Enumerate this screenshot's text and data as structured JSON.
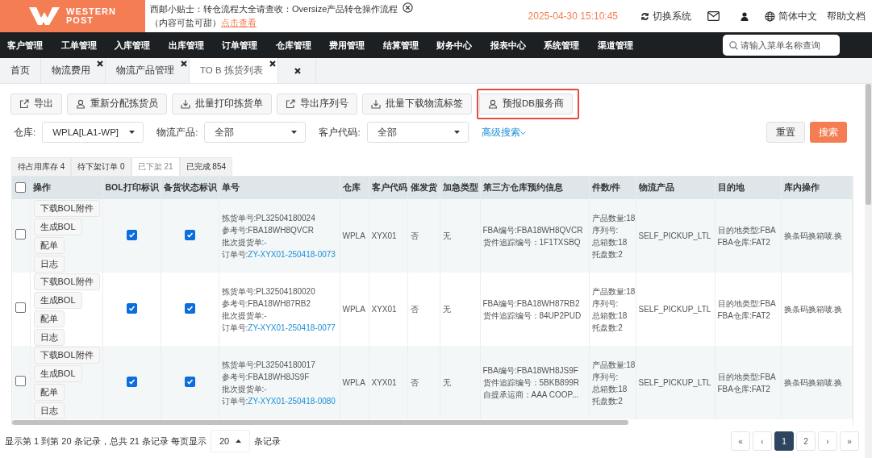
{
  "header": {
    "logo_text": [
      "WESTERN",
      "POST"
    ],
    "notice": {
      "line1": "西邮小贴士：转仓流程大全请查收：Oversize产品转仓操作流程",
      "line2": "（内容可盐可甜）",
      "link": "点击查看"
    },
    "datetime": "2025-04-30 15:10:45",
    "switch_system": "切换系统",
    "language": "简体中文",
    "help": "帮助文档"
  },
  "nav": {
    "items": [
      "客户管理",
      "工单管理",
      "入库管理",
      "出库管理",
      "订单管理",
      "仓库管理",
      "费用管理",
      "结算管理",
      "财务中心",
      "报表中心",
      "系统管理",
      "渠道管理"
    ],
    "search_placeholder": "请输入菜单名称查询"
  },
  "page_tabs": [
    {
      "label": "首页",
      "closable": false,
      "selected": false
    },
    {
      "label": "物流费用",
      "closable": true,
      "selected": false
    },
    {
      "label": "物流产品管理",
      "closable": true,
      "selected": false
    },
    {
      "label": "TO B 拣货列表",
      "closable": true,
      "selected": true
    },
    {
      "closable": true,
      "selected": false
    }
  ],
  "toolbar": [
    {
      "label": "导出",
      "highlighted": false
    },
    {
      "label": "重新分配拣货员",
      "highlighted": false
    },
    {
      "label": "批量打印拣货单",
      "highlighted": false
    },
    {
      "label": "导出序列号",
      "highlighted": false
    },
    {
      "label": "批量下载物流标签",
      "highlighted": false
    },
    {
      "label": "预报DB服务商",
      "highlighted": true
    }
  ],
  "filters": [
    {
      "label": "仓库:",
      "value": "WPLA[LA1-WP]"
    },
    {
      "label": "物流产品:",
      "value": "全部"
    },
    {
      "label": "客户代码:",
      "value": "全部"
    }
  ],
  "advanced_search": "高级搜索",
  "reset_button": "重置",
  "search_button": "搜索",
  "status_tabs": [
    {
      "label": "待占用库存 4",
      "selected": false
    },
    {
      "label": "待下架订单 0",
      "selected": false
    },
    {
      "label": "已下架 21",
      "selected": true
    },
    {
      "label": "已完成 854",
      "selected": false
    }
  ],
  "table": {
    "all_selected": false,
    "columns": [
      "操作",
      "BOL打印标识",
      "备货状态标识",
      "单号",
      "仓库",
      "客户代码",
      "催发货",
      "加急类型",
      "第三方仓库预约信息",
      "件数/件",
      "物流产品",
      "目的地",
      "库内操作"
    ],
    "rows": [
      {
        "selected": false,
        "actions": [
          "下载BOL附件",
          "生成BOL",
          "配单",
          "日志"
        ],
        "bol_printed": true,
        "stock_ready": true,
        "order_info": [
          {
            "label": "拣货单号:",
            "value": "PL32504180024",
            "link": false
          },
          {
            "label": "参考号:",
            "value": "FBA18WH8QVCR",
            "link": false
          },
          {
            "label": "批次提货单:",
            "value": "-",
            "link": true
          },
          {
            "label": "订单号:",
            "value": "ZY-XYX01-250418-0073",
            "link": true
          }
        ],
        "warehouse": "WPLA",
        "customer": "XYX01",
        "urge": "否",
        "urgent_type": "无",
        "third_party": [
          "FBA编号:FBA18WH8QVCR",
          "货件追踪编号：1F1TXSBQ"
        ],
        "counts": [
          "产品数量:18",
          "序列号:",
          "总箱数:18",
          "托盘数:2"
        ],
        "product": "SELF_PICKUP_LTL",
        "destination": [
          "目的地类型:FBA",
          "FBA仓库:FAT2"
        ],
        "operations": "换条码换箱唛.换"
      },
      {
        "selected": false,
        "actions": [
          "下载BOL附件",
          "生成BOL",
          "配单",
          "日志"
        ],
        "bol_printed": true,
        "stock_ready": true,
        "order_info": [
          {
            "label": "拣货单号:",
            "value": "PL32504180020",
            "link": false
          },
          {
            "label": "参考号:",
            "value": "FBA18WH87RB2",
            "link": false
          },
          {
            "label": "批次提货单:",
            "value": "-",
            "link": true
          },
          {
            "label": "订单号:",
            "value": "ZY-XYX01-250418-0077",
            "link": true
          }
        ],
        "warehouse": "WPLA",
        "customer": "XYX01",
        "urge": "否",
        "urgent_type": "无",
        "third_party": [
          "FBA编号:FBA18WH87RB2",
          "货件追踪编号：84UP2PUD"
        ],
        "counts": [
          "产品数量:18",
          "序列号:",
          "总箱数:18",
          "托盘数:2"
        ],
        "product": "SELF_PICKUP_LTL",
        "destination": [
          "目的地类型:FBA",
          "FBA仓库:FAT2"
        ],
        "operations": "换条码换箱唛.换"
      },
      {
        "selected": false,
        "actions": [
          "下载BOL附件",
          "生成BOL",
          "配单",
          "日志"
        ],
        "bol_printed": true,
        "stock_ready": true,
        "order_info": [
          {
            "label": "拣货单号:",
            "value": "PL32504180017",
            "link": false
          },
          {
            "label": "参考号:",
            "value": "FBA18WH8JS9F",
            "link": false
          },
          {
            "label": "批次提货单:",
            "value": "-",
            "link": true
          },
          {
            "label": "订单号:",
            "value": "ZY-XYX01-250418-0080",
            "link": true
          }
        ],
        "warehouse": "WPLA",
        "customer": "XYX01",
        "urge": "否",
        "urgent_type": "无",
        "third_party": [
          "FBA编号:FBA18WH8JS9F",
          "货件追踪编号：5BKB899R",
          "自提承运商：AAA COOP..."
        ],
        "counts": [
          "产品数量:18",
          "序列号:",
          "总箱数:18",
          "托盘数:2"
        ],
        "product": "SELF_PICKUP_LTL",
        "destination": [
          "目的地类型:FBA",
          "FBA仓库:FAT2"
        ],
        "operations": "换条码换箱唛.换"
      }
    ]
  },
  "footer": {
    "summary": "显示第 1 到第 20 条记录，总共 21 条记录 每页显示",
    "page_size": "20",
    "suffix": "条记录"
  },
  "pagination": [
    {
      "label": "«",
      "selected": false
    },
    {
      "label": "‹",
      "selected": false
    },
    {
      "label": "1",
      "selected": true
    },
    {
      "label": "2",
      "selected": false
    },
    {
      "label": "›",
      "selected": false
    },
    {
      "label": "»",
      "selected": false
    }
  ]
}
